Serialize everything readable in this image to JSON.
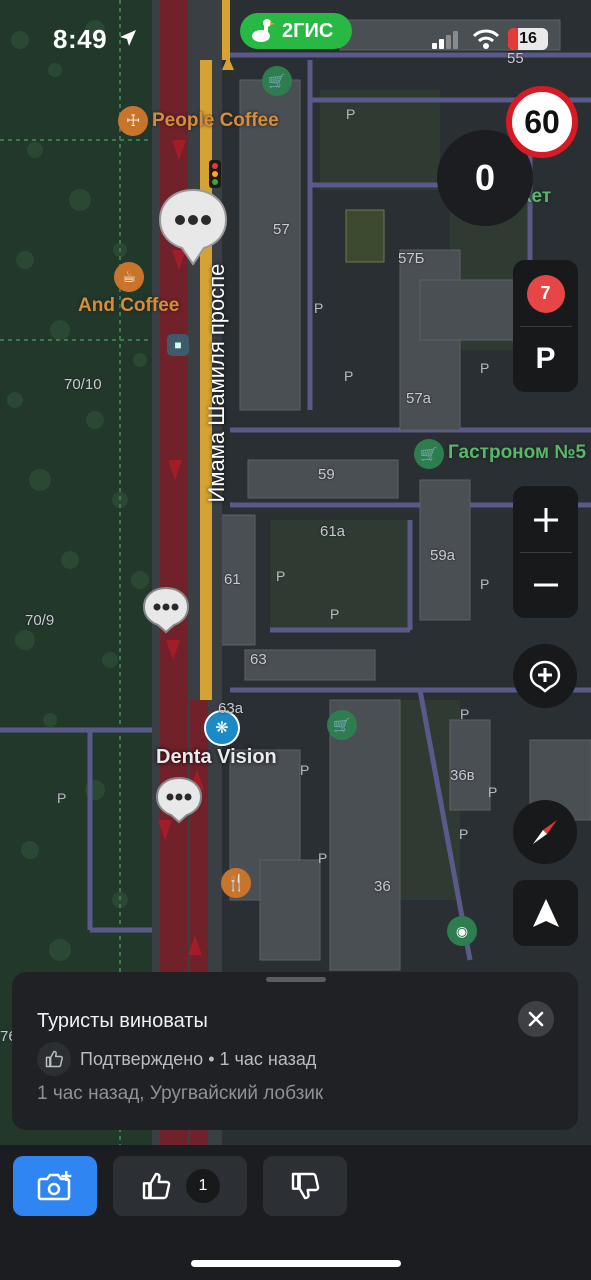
{
  "status_bar": {
    "time": "8:49",
    "battery": "16",
    "app_badge": "2ГИС"
  },
  "map": {
    "street_name": "Имама Шамиля проспе",
    "pois": {
      "people_coffee": "People Coffee",
      "and_coffee": "And Coffee",
      "gastronom": "Гастроном №5",
      "market": "кет",
      "denta": "Denta Vision"
    },
    "building_numbers": [
      "55",
      "57",
      "57Б",
      "57а",
      "59",
      "61а",
      "59а",
      "61",
      "63",
      "63а",
      "36в",
      "36",
      "70/10",
      "70/9",
      "76"
    ],
    "parking_letter": "P"
  },
  "controls": {
    "speed_limit": "60",
    "current_speed": "0",
    "events_count": "7",
    "parking_label": "P"
  },
  "card": {
    "title": "Туристы виноваты",
    "confirmation": "Подтверждено • 1 час назад",
    "subtitle": "1 час назад, Уругвайский лобзик"
  },
  "actions": {
    "like_count": "1"
  },
  "colors": {
    "accent_blue": "#2f85f2",
    "brand_green": "#27b944",
    "speed_red": "#d71a23",
    "traffic_red": "#8b1a22",
    "traffic_yellow": "#d6a233",
    "poi_orange": "#d78c3a"
  }
}
